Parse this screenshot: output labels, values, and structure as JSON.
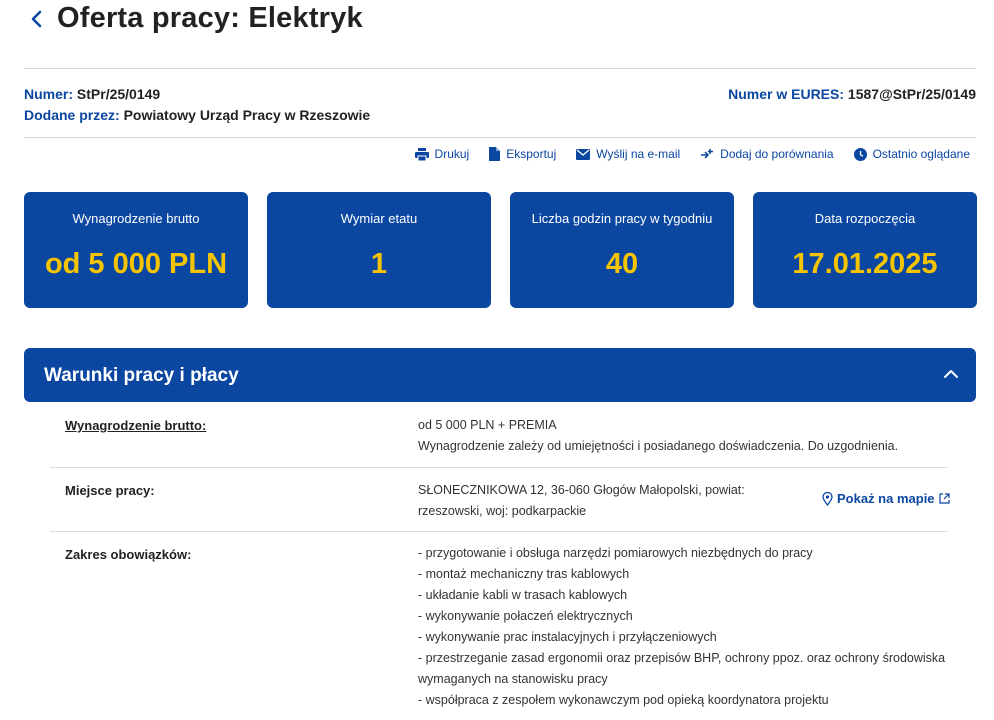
{
  "header": {
    "title": "Oferta pracy: Elektryk"
  },
  "meta": {
    "number_label": "Numer:",
    "number_value": "StPr/25/0149",
    "added_label": "Dodane przez:",
    "added_value": "Powiatowy Urząd Pracy w Rzeszowie",
    "eures_label": "Numer w EURES:",
    "eures_value": "1587@StPr/25/0149"
  },
  "actions": [
    {
      "label": "Drukuj",
      "icon": "printer-icon"
    },
    {
      "label": "Eksportuj",
      "icon": "document-icon"
    },
    {
      "label": "Wyślij na e-mail",
      "icon": "mail-icon"
    },
    {
      "label": "Dodaj do porównania",
      "icon": "compare-icon"
    },
    {
      "label": "Ostatnio oglądane",
      "icon": "clock-icon"
    }
  ],
  "cards": [
    {
      "label": "Wynagrodzenie brutto",
      "value": "od 5 000 PLN"
    },
    {
      "label": "Wymiar etatu",
      "value": "1"
    },
    {
      "label": "Liczba godzin pracy w tygodniu",
      "value": "40"
    },
    {
      "label": "Data rozpoczęcia",
      "value": "17.01.2025"
    }
  ],
  "panel": {
    "title": "Warunki pracy i płacy",
    "salary_label": "Wynagrodzenie brutto:",
    "salary_line1": "od 5 000 PLN + PREMIA",
    "salary_line2": "Wynagrodzenie zależy od umiejętności i posiadanego doświadczenia. Do uzgodnienia.",
    "place_label": "Miejsce pracy:",
    "place_line1": "SŁONECZNIKOWA 12, 36-060 Głogów Małopolski, powiat:",
    "place_line2": "rzeszowski, woj: podkarpackie",
    "map_link": "Pokaż na mapie",
    "duties_label": "Zakres obowiązków:",
    "duties": [
      "- przygotowanie i obsługa narzędzi pomiarowych niezbędnych do pracy",
      "- montaż mechaniczny tras kablowych",
      "- układanie kabli w trasach kablowych",
      "- wykonywanie połaczeń elektrycznych",
      "- wykonywanie prac instalacyjnych i przyłączeniowych",
      "- przestrzeganie zasad ergonomii oraz przepisów BHP, ochrony ppoz. oraz ochrony środowiska",
      "wymaganych na stanowisku pracy",
      "- współpraca z zespołem wykonawczym pod opieką koordynatora projektu"
    ]
  },
  "colors": {
    "primary": "#0b47a1",
    "accent": "#f6c400"
  }
}
